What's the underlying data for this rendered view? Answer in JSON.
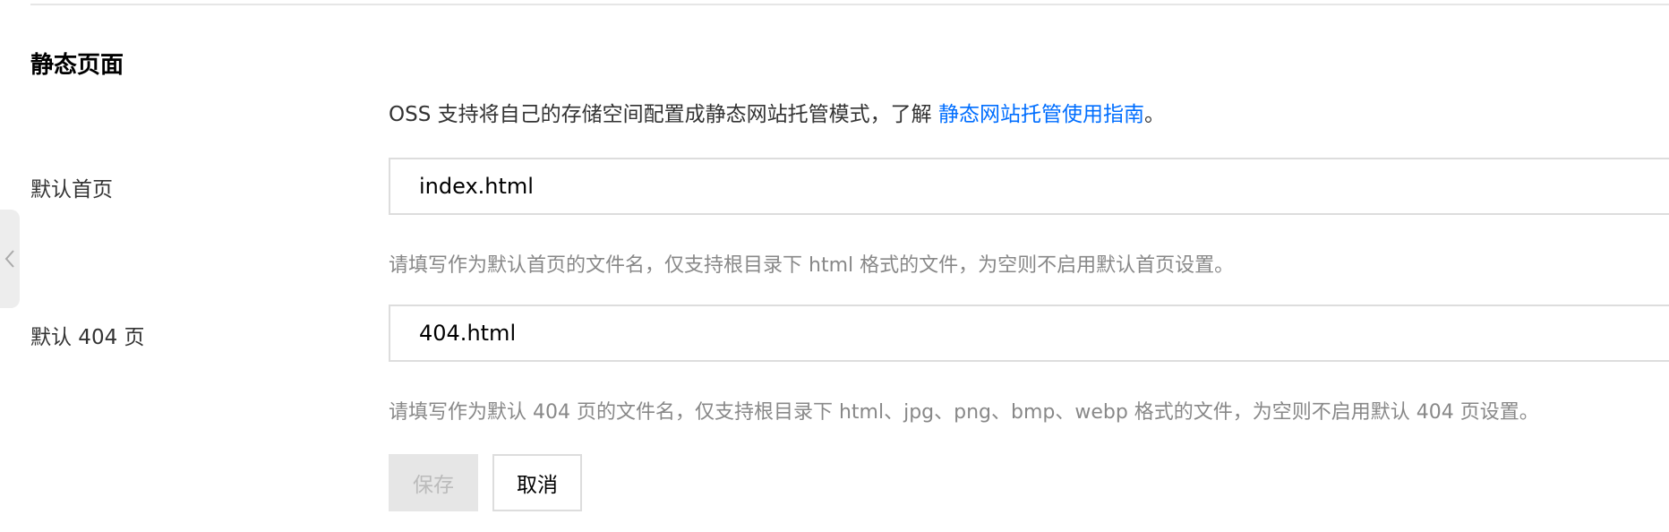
{
  "section": {
    "title": "静态页面",
    "intro_text": "OSS 支持将自己的存储空间配置成静态网站托管模式，了解",
    "intro_link": "静态网站托管使用指南",
    "intro_end": "。"
  },
  "index_page": {
    "label": "默认首页",
    "value": "index.html",
    "hint": "请填写作为默认首页的文件名，仅支持根目录下 html 格式的文件，为空则不启用默认首页设置。"
  },
  "error_page": {
    "label": "默认 404 页",
    "value": "404.html",
    "hint": "请填写作为默认 404 页的文件名，仅支持根目录下 html、jpg、png、bmp、webp 格式的文件，为空则不启用默认 404 页设置。"
  },
  "buttons": {
    "save": "保存",
    "cancel": "取消"
  },
  "icons": {
    "collapse": "chevron-left-icon"
  },
  "colors": {
    "link": "#006eff",
    "hint": "#888888",
    "disabled_bg": "#e6e6e6",
    "border": "#dddddd"
  }
}
